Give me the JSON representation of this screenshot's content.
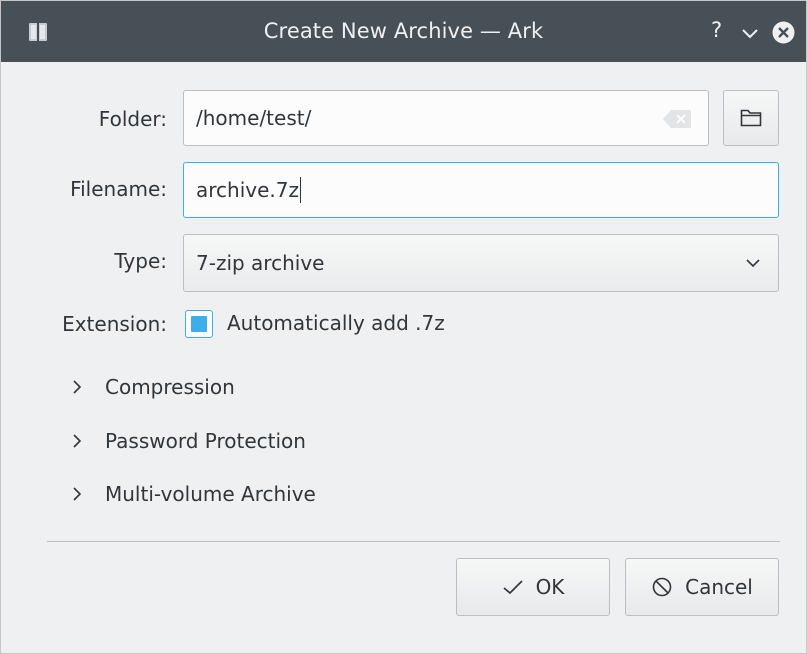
{
  "window": {
    "title": "Create New Archive — Ark",
    "help_glyph": "?"
  },
  "form": {
    "folder_label": "Folder:",
    "folder_value": "/home/test/",
    "filename_label": "Filename:",
    "filename_value": "archive.7z",
    "type_label": "Type:",
    "type_value": "7-zip archive",
    "extension_label": "Extension:",
    "extension_checkbox_label": "Automatically add .7z",
    "extension_checked": true
  },
  "sections": [
    {
      "label": "Compression",
      "expanded": false
    },
    {
      "label": "Password Protection",
      "expanded": false
    },
    {
      "label": "Multi-volume Archive",
      "expanded": false
    }
  ],
  "buttons": {
    "ok_label": "OK",
    "cancel_label": "Cancel"
  },
  "icons": {
    "app": "ark-app-icon",
    "minimize": "chevron-down-icon",
    "close": "close-icon",
    "clear": "clear-text-icon",
    "browse": "folder-icon",
    "combo": "chevron-down-icon",
    "expander": "chevron-right-icon",
    "ok": "checkmark-icon",
    "cancel": "cancel-icon"
  },
  "colors": {
    "titlebar_bg": "#475057",
    "window_bg": "#eff0f1",
    "accent": "#3daee9",
    "text": "#31363b"
  }
}
